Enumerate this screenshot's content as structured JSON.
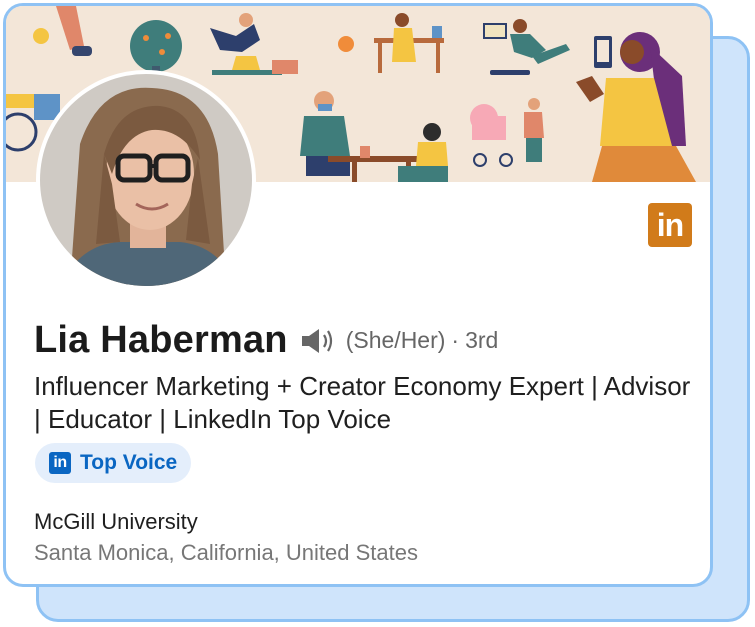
{
  "profile": {
    "name": "Lia Haberman",
    "pronouns": "(She/Her)",
    "separator": "·",
    "degree": "3rd",
    "headline": "Influencer Marketing + Creator Economy Expert | Advisor | Educator | LinkedIn Top Voice",
    "badge_label": "Top Voice",
    "badge_icon_text": "in",
    "education": "McGill University",
    "location": "Santa Monica, California, United States"
  },
  "brand": {
    "logo_text": "in",
    "logo_color": "#d17b1a",
    "badge_color": "#0a66c2",
    "card_border": "#8ec2f4"
  },
  "icons": {
    "speaker": "speaker-icon",
    "linkedin_logo": "linkedin-logo-icon",
    "badge": "linkedin-badge-icon"
  }
}
